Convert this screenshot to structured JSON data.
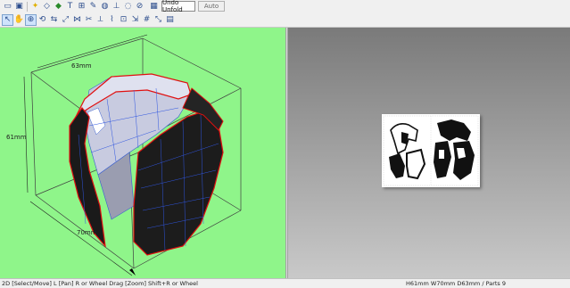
{
  "toolbar_top": {
    "unfold_label": "Undo Unfold",
    "auto_label": "Auto",
    "icons": [
      "new-file-icon",
      "save-icon",
      "wand-icon",
      "plane-tool-icon",
      "color-tool-icon",
      "text-tool-icon",
      "fold-icon",
      "paint-icon",
      "cylinder-icon",
      "cone-icon",
      "ring-icon",
      "glue-tab-icon",
      "text-box-icon",
      "text-box-icon-2",
      "grid-icon"
    ]
  },
  "toolbar_second": {
    "icons": [
      "select-move-icon",
      "pan-icon",
      "zoom-icon",
      "rotate-icon",
      "flip-icon",
      "edit-edges-icon",
      "join-icon",
      "split-icon",
      "edge-icon",
      "fold-line-icon",
      "arrange-parts-icon",
      "scale-icon",
      "grid-snap-icon",
      "fit-icon",
      "page-icon"
    ]
  },
  "view3d": {
    "dimension_top": "63mm",
    "dimension_left": "61mm",
    "dimension_bottom": "70mm",
    "background_color": "#8ff58a"
  },
  "status": {
    "left": "2D [Select/Move] L [Pan] R or Wheel Drag [Zoom] Shift+R or Wheel",
    "right": "H61mm W70mm D63mm / Parts 9"
  }
}
